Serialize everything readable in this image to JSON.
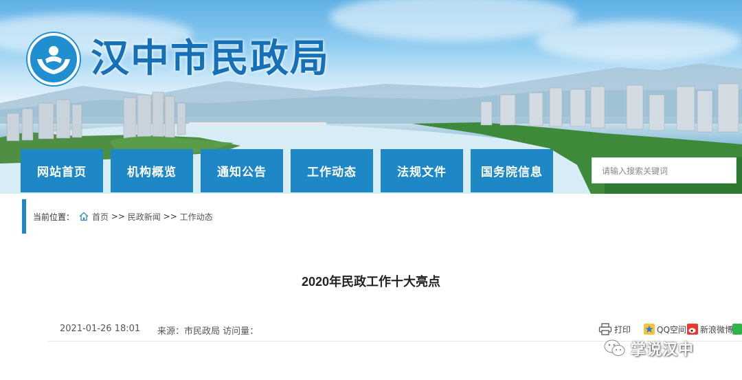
{
  "header": {
    "site_title": "汉中市民政局"
  },
  "nav": {
    "items": [
      {
        "label": "网站首页"
      },
      {
        "label": "机构概览"
      },
      {
        "label": "通知公告"
      },
      {
        "label": "工作动态"
      },
      {
        "label": "法规文件"
      },
      {
        "label": "国务院信息"
      }
    ]
  },
  "search": {
    "placeholder": "请输入搜索关键词"
  },
  "breadcrumb": {
    "prefix": "当前位置：",
    "items": [
      "首页",
      "民政新闻",
      "工作动态"
    ],
    "separator": ">>"
  },
  "article": {
    "title": "2020年民政工作十大亮点",
    "date": "2021-01-26 18:01",
    "source_label": "来源：",
    "source": "市民政局",
    "views_label": "访问量："
  },
  "share": {
    "print": "打印",
    "qzone": "QQ空间",
    "weibo": "新浪微博"
  },
  "watermark": {
    "text": "掌说汉中"
  },
  "colors": {
    "brand_blue": "#1e88c7",
    "title_blue": "#1570b8"
  },
  "icons": [
    "logo-emblem",
    "home-icon",
    "print-icon",
    "qzone-icon",
    "weibo-icon",
    "wechat-icon"
  ]
}
